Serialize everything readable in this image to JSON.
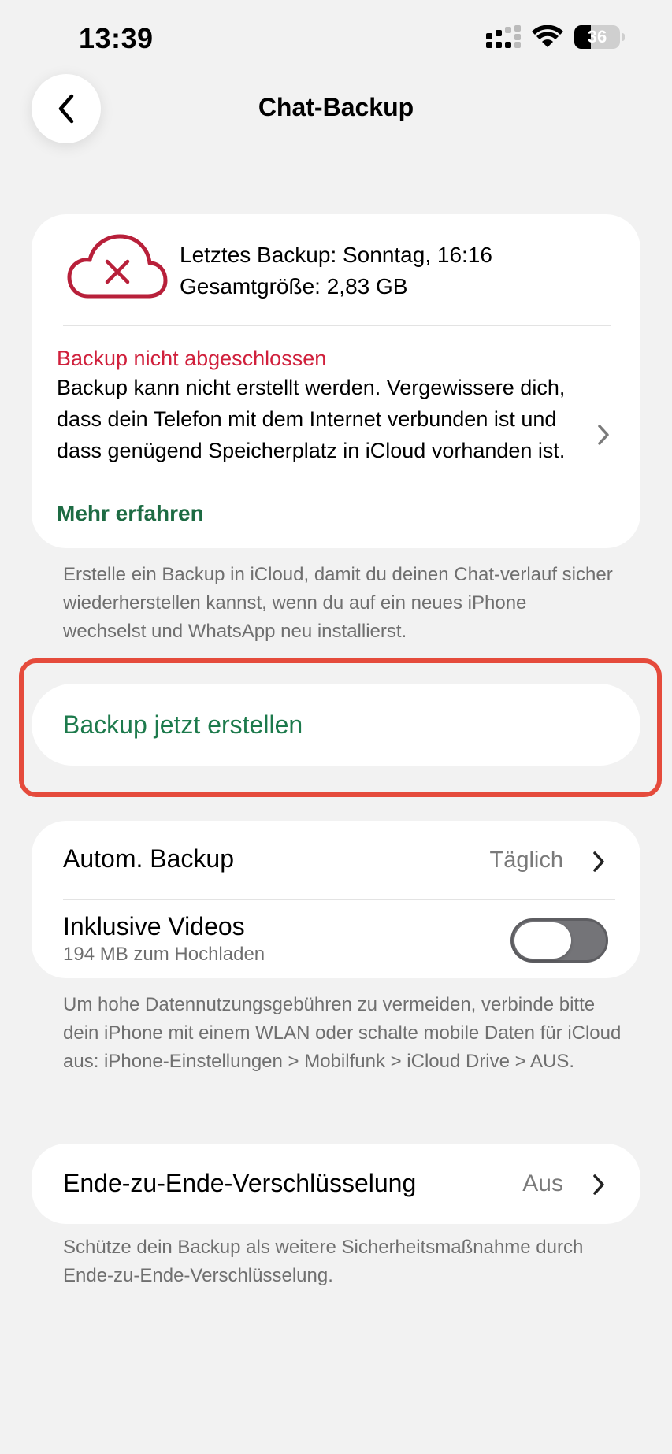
{
  "status_bar": {
    "time": "13:39",
    "battery_level": "36",
    "icons": [
      "signal-icon",
      "wifi-icon",
      "battery-icon"
    ]
  },
  "header": {
    "title": "Chat-Backup",
    "back_icon": "chevron-left-icon"
  },
  "status_card": {
    "cloud_icon": "cloud-error-icon",
    "last_backup": "Letztes Backup: Sonntag, 16:16",
    "total_size": "Gesamtgröße: 2,83 GB",
    "warning_title": "Backup nicht abgeschlossen",
    "warning_body": "Backup kann nicht erstellt werden. Vergewissere dich, dass dein Telefon mit dem Internet verbunden ist und dass genügend Speicherplatz in iCloud vorhanden ist.",
    "more_link": "Mehr erfahren"
  },
  "info_text": "Erstelle ein Backup in iCloud, damit du deinen Chat-verlauf sicher wiederherstellen kannst, wenn du auf ein neues iPhone wechselst und WhatsApp neu installierst.",
  "backup_now_label": "Backup jetzt erstellen",
  "settings": {
    "auto_backup_label": "Autom. Backup",
    "auto_backup_value": "Täglich",
    "include_videos_label": "Inklusive Videos",
    "include_videos_sub": "194 MB zum Hochladen",
    "include_videos_on": false
  },
  "data_usage_note": "Um hohe Datennutzungsgebühren zu vermeiden, verbinde bitte dein iPhone mit einem WLAN oder schalte mobile Daten für iCloud aus: iPhone-Einstellungen > Mobilfunk > iCloud Drive > AUS.",
  "encryption": {
    "label": "Ende-zu-Ende-Verschlüsselung",
    "value": "Aus",
    "note": "Schütze dein Backup als weitere Sicherheitsmaßnahme durch Ende-zu-Ende-Verschlüsselung."
  },
  "colors": {
    "accent_green": "#1d7a4c",
    "link_green": "#1d6b43",
    "error_red": "#d0203c",
    "highlight": "#e54b3c",
    "background": "#f2f2f2"
  }
}
